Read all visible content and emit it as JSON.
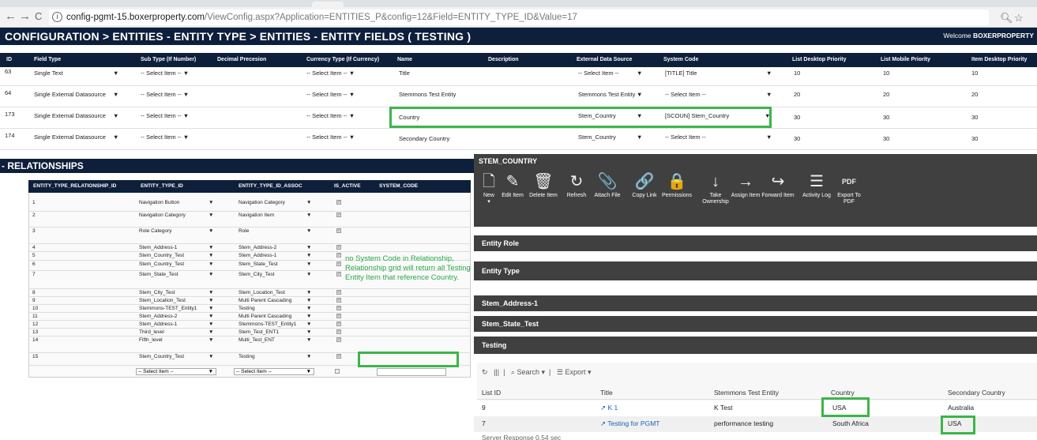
{
  "browser": {
    "url_host": "config-pgmt-15.boxerproperty.com",
    "url_rest": "/ViewConfig.aspx?Application=ENTITIES_P&config=12&Field=ENTITY_TYPE_ID&Value=17",
    "back_icon": "←",
    "forward_icon": "→",
    "reload_icon": "C",
    "info_icon": "i"
  },
  "header": {
    "breadcrumb": "CONFIGURATION > ENTITIES - ENTITY TYPE > ENTITIES - ENTITY FIELDS ( TESTING )",
    "welcome_prefix": "Welcome ",
    "welcome_user": "BOXERPROPERTY"
  },
  "fields_table": {
    "headers": [
      "ID",
      "Field Type",
      "Sub Type (If Number)",
      "Decimal Precesion",
      "Currency Type (If Currency)",
      "Name",
      "Description",
      "External Data Source",
      "System Code",
      "List Desktop Priority",
      "List Mobile Priority",
      "Item Desktop Priority"
    ],
    "rows": [
      {
        "id": "63",
        "field_type": "Single Text",
        "sub_type": "-- Select Item --",
        "currency": "-- Select Item --",
        "name": "Title",
        "ext_source": "-- Select Item --",
        "system_code": "[TITLE] Title",
        "list_desktop": "10",
        "list_mobile": "10",
        "item_desktop": "10"
      },
      {
        "id": "64",
        "field_type": "Single External Datasource",
        "sub_type": "-- Select Item --",
        "currency": "-- Select Item --",
        "name": "Stemmons Test Entity",
        "ext_source": "Stemmons Test Entity",
        "system_code": "-- Select Item --",
        "list_desktop": "20",
        "list_mobile": "20",
        "item_desktop": "20"
      },
      {
        "id": "173",
        "field_type": "Single External Datasource",
        "sub_type": "-- Select Item --",
        "currency": "-- Select Item --",
        "name": "Country",
        "ext_source": "Stem_Country",
        "system_code": "[SCOUN] Stem_Country",
        "list_desktop": "30",
        "list_mobile": "30",
        "item_desktop": "30"
      },
      {
        "id": "174",
        "field_type": "Single External Datasource",
        "sub_type": "-- Select Item --",
        "currency": "-- Select Item --",
        "name": "Secondary Country",
        "ext_source": "Stem_Country",
        "system_code": "-- Select Item --",
        "list_desktop": "30",
        "list_mobile": "30",
        "item_desktop": "30"
      }
    ]
  },
  "relationships": {
    "title": "RELATIONSHIPS",
    "headers": [
      "ENTITY_TYPE_RELATIONSHIP_ID",
      "ENTITY_TYPE_ID",
      "ENTITY_TYPE_ID_ASSOC",
      "IS_ACTIVE",
      "SYSTEM_CODE"
    ],
    "rows": [
      {
        "id": "1",
        "type": "Navigation Button",
        "assoc": "Navigation Category"
      },
      {
        "id": "2",
        "type": "Navigation Category",
        "assoc": "Navigation Item"
      },
      {
        "id": "3",
        "type": "Role Category",
        "assoc": "Role"
      },
      {
        "id": "4",
        "type": "Stem_Address-1",
        "assoc": "Stem_Address-2"
      },
      {
        "id": "5",
        "type": "Stem_Country_Test",
        "assoc": "Stem_Address-1"
      },
      {
        "id": "6",
        "type": "Stem_Country_Test",
        "assoc": "Stem_State_Test"
      },
      {
        "id": "7",
        "type": "Stem_State_Test",
        "assoc": "Stem_City_Test"
      },
      {
        "id": "8",
        "type": "Stem_City_Test",
        "assoc": "Stem_Location_Test"
      },
      {
        "id": "9",
        "type": "Stem_Location_Test",
        "assoc": "Multi Parent Cascading"
      },
      {
        "id": "10",
        "type": "Stemmons-TEST_Entity1",
        "assoc": "Testing"
      },
      {
        "id": "11",
        "type": "Stem_Address-2",
        "assoc": "Multi Parent Cascading"
      },
      {
        "id": "12",
        "type": "Stem_Address-1",
        "assoc": "Stemmons-TEST_Entity1"
      },
      {
        "id": "13",
        "type": "Third_level",
        "assoc": "Stem_Test_ENT1"
      },
      {
        "id": "14",
        "type": "Fifth_level",
        "assoc": "Multi_Test_ENT"
      },
      {
        "id": "15",
        "type": "Stem_Country_Test",
        "assoc": "Testing"
      }
    ],
    "new_row_type": "-- Select Item --",
    "new_row_assoc": "-- Select Item --",
    "note": "no System Code in Relationship, Relationship grid will return all Testing Entity Item that reference Country."
  },
  "panel": {
    "title": "STEM_COUNTRY",
    "toolbar": [
      {
        "label": "New",
        "icon": "🗋"
      },
      {
        "label": "Edit Item",
        "icon": "✎"
      },
      {
        "label": "Delete Item",
        "icon": "🗑"
      },
      {
        "label": "Refresh",
        "icon": "↻"
      },
      {
        "label": "Attach File",
        "icon": "📎"
      },
      {
        "label": "Copy Link",
        "icon": "🔗"
      },
      {
        "label": "Permissions",
        "icon": "🔒"
      },
      {
        "label": "Take Ownership",
        "icon": "↓"
      },
      {
        "label": "Assign Item",
        "icon": "→"
      },
      {
        "label": "Forward Item",
        "icon": "↪"
      },
      {
        "label": "Activity Log",
        "icon": "☰"
      },
      {
        "label": "Export To PDF",
        "icon": "PDF"
      }
    ],
    "sections": [
      "Entity Role",
      "Entity Type",
      "Stem_Address-1",
      "Stem_State_Test",
      "Testing"
    ],
    "grid_tools": {
      "search": "Search",
      "export": "Export"
    },
    "grid_headers": [
      "List ID",
      "Title",
      "Stemmons Test Entity",
      "Country",
      "Secondary Country"
    ],
    "grid_rows": [
      {
        "id": "9",
        "title": "K 1",
        "entity": "K Test",
        "country": "USA",
        "secondary": "Australia"
      },
      {
        "id": "7",
        "title": "Testing for PGMT",
        "entity": "performance testing",
        "country": "South Africa",
        "secondary": "USA"
      }
    ],
    "server_response": "Server Response 0.54 sec"
  },
  "colors": {
    "header_bg": "#0d1f3a",
    "panel_bg": "#404040",
    "highlight": "#3cb54a",
    "note": "#28a745"
  }
}
